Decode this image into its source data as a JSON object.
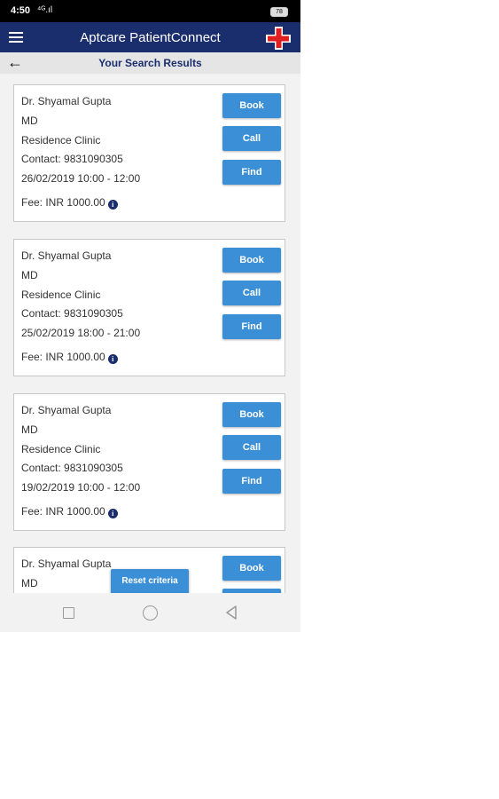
{
  "status_bar": {
    "time": "4:50",
    "signal": "⁴ᴳ.ıl",
    "battery": "78"
  },
  "app_bar": {
    "title": "Aptcare PatientConnect"
  },
  "sub_header": {
    "title": "Your Search Results"
  },
  "cards": [
    {
      "doctor": "Dr. Shyamal Gupta",
      "degree": "MD",
      "clinic": "Residence Clinic",
      "contact": "Contact:  9831090305",
      "slot": "26/02/2019  10:00 - 12:00",
      "fee": "Fee: INR 1000.00",
      "book": "Book",
      "call": "Call",
      "find": "Find"
    },
    {
      "doctor": "Dr. Shyamal Gupta",
      "degree": "MD",
      "clinic": "Residence Clinic",
      "contact": "Contact:  9831090305",
      "slot": "25/02/2019  18:00 - 21:00",
      "fee": "Fee: INR 1000.00",
      "book": "Book",
      "call": "Call",
      "find": "Find"
    },
    {
      "doctor": "Dr. Shyamal Gupta",
      "degree": "MD",
      "clinic": "Residence Clinic",
      "contact": "Contact:  9831090305",
      "slot": "19/02/2019  10:00 - 12:00",
      "fee": "Fee: INR 1000.00",
      "book": "Book",
      "call": "Call",
      "find": "Find"
    },
    {
      "doctor": "Dr. Shyamal Gupta",
      "degree": "MD",
      "book": "Book"
    }
  ],
  "reset_button": "Reset criteria",
  "info_icon_glyph": "i",
  "colors": {
    "app_bar": "#1a2e6e",
    "button": "#3a8fd6",
    "logo_red": "#e02020"
  }
}
